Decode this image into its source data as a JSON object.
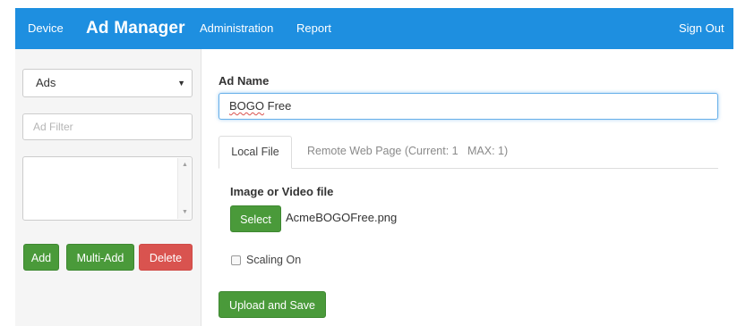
{
  "nav": {
    "device": "Device",
    "brand": "Ad Manager",
    "administration": "Administration",
    "report": "Report",
    "sign_out": "Sign Out"
  },
  "sidebar": {
    "select_value": "Ads",
    "filter_placeholder": "Ad Filter",
    "add_label": "Add",
    "multi_add_label": "Multi-Add",
    "delete_label": "Delete"
  },
  "form": {
    "ad_name_label": "Ad Name",
    "ad_name_value_misspelled": "BOGO",
    "ad_name_value_rest": " Free",
    "tabs": [
      {
        "label": "Local File",
        "active": true
      },
      {
        "label": "Remote Web Page (Current: 1   MAX: 1)",
        "active": false
      }
    ],
    "file_label": "Image or Video file",
    "select_label": "Select",
    "file_name": "AcmeBOGOFree.png",
    "scaling_label": "Scaling On",
    "scaling_checked": false,
    "upload_label": "Upload and Save"
  },
  "colors": {
    "navbar": "#1e8fe0",
    "success": "#4a9a3a",
    "danger": "#d9534f",
    "focus": "#66afe9"
  }
}
